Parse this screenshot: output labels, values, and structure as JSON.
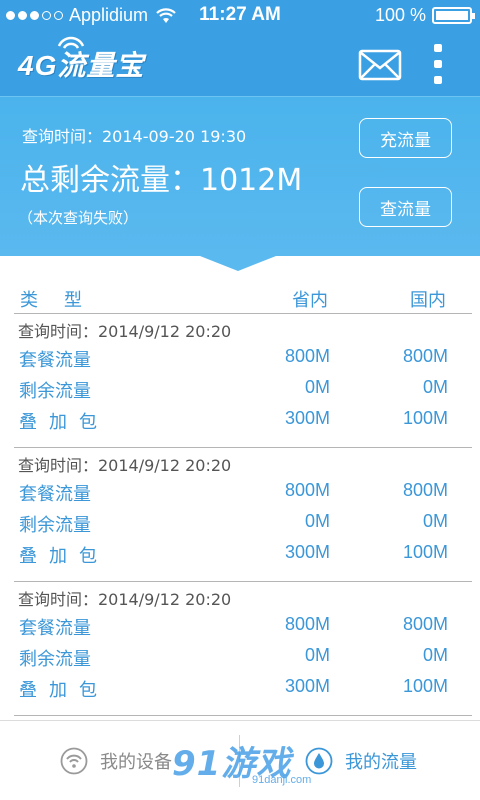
{
  "status_bar": {
    "carrier": "Applidium",
    "time": "11:27 AM",
    "battery": "100 %"
  },
  "app_bar": {
    "logo_text": "4G流量宝"
  },
  "summary": {
    "query_time": "查询时间：2014-09-20 19:30",
    "total": "总剩余流量：1012M",
    "note": "（本次查询失败）",
    "recharge_label": "充流量",
    "query_label": "查流量"
  },
  "table": {
    "headers": [
      "类型",
      "省内",
      "国内"
    ],
    "blocks": [
      {
        "time": "查询时间：2014/9/12   20:20",
        "rows": [
          {
            "name": "套餐流量",
            "province": "800M",
            "national": "800M"
          },
          {
            "name": "剩余流量",
            "province": "0M",
            "national": "0M"
          },
          {
            "name": "叠加包",
            "province": "300M",
            "national": "100M"
          }
        ]
      },
      {
        "time": "查询时间：2014/9/12   20:20",
        "rows": [
          {
            "name": "套餐流量",
            "province": "800M",
            "national": "800M"
          },
          {
            "name": "剩余流量",
            "province": "0M",
            "national": "0M"
          },
          {
            "name": "叠加包",
            "province": "300M",
            "national": "100M"
          }
        ]
      },
      {
        "time": "查询时间：2014/9/12   20:20",
        "rows": [
          {
            "name": "套餐流量",
            "province": "800M",
            "national": "800M"
          },
          {
            "name": "剩余流量",
            "province": "0M",
            "national": "0M"
          },
          {
            "name": "叠加包",
            "province": "300M",
            "national": "100M"
          }
        ]
      }
    ]
  },
  "tab_bar": {
    "device_label": "我的设备",
    "traffic_label": "我的流量"
  },
  "watermark": {
    "main": "91游戏",
    "sub": "91danji.com"
  },
  "colors": {
    "primary": "#3aa0e3",
    "accent_text": "#3b97d8"
  }
}
